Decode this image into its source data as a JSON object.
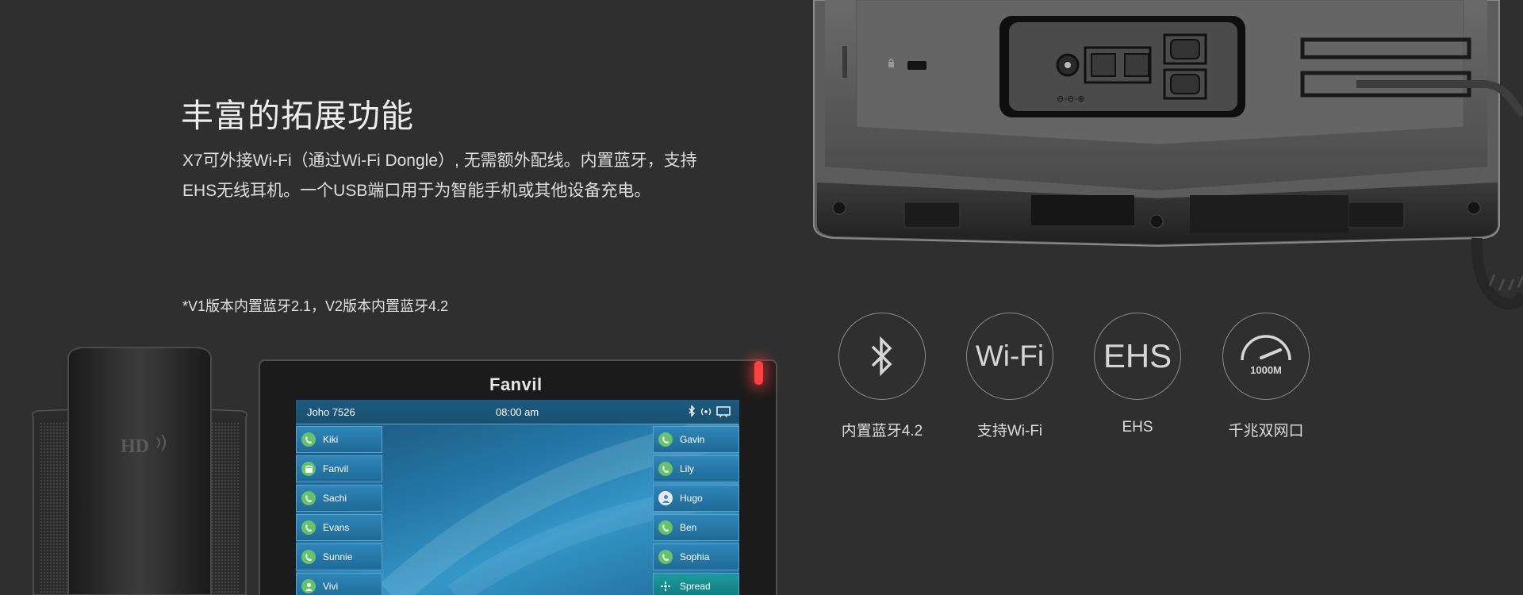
{
  "heading": {
    "title": "丰富的拓展功能",
    "description_line1": "X7可外接Wi-Fi（通过Wi-Fi Dongle）, 无需额外配线。内置蓝牙，支持",
    "description_line2": "EHS无线耳机。一个USB端口用于为智能手机或其他设备充电。",
    "note": "*V1版本内置蓝牙2.1，V2版本内置蓝牙4.2"
  },
  "features": [
    {
      "icon": "bluetooth-icon",
      "icon_text": "",
      "label": "内置蓝牙4.2"
    },
    {
      "icon": "wifi-text-icon",
      "icon_text": "Wi-Fi",
      "label": "支持Wi-Fi"
    },
    {
      "icon": "ehs-text-icon",
      "icon_text": "EHS",
      "label": "EHS"
    },
    {
      "icon": "speedometer-icon",
      "icon_text": "1000M",
      "label": "千兆双网口"
    }
  ],
  "phone": {
    "brand": "Fanvil",
    "handset_logo": "HD",
    "status_user": "Joho  7526",
    "status_time": "08:00 am",
    "contacts_left": [
      "Kiki",
      "Fanvil",
      "Sachi",
      "Evans",
      "Sunnie",
      "Vivi"
    ],
    "contacts_right": [
      "Gavin",
      "Lily",
      "Hugo",
      "Ben",
      "Sophia",
      "Spread"
    ]
  },
  "colors": {
    "background": "#2f2f2f",
    "screen_blue": "#2376a5",
    "contact_green": "#66c36b",
    "led_red": "#ff4040"
  }
}
